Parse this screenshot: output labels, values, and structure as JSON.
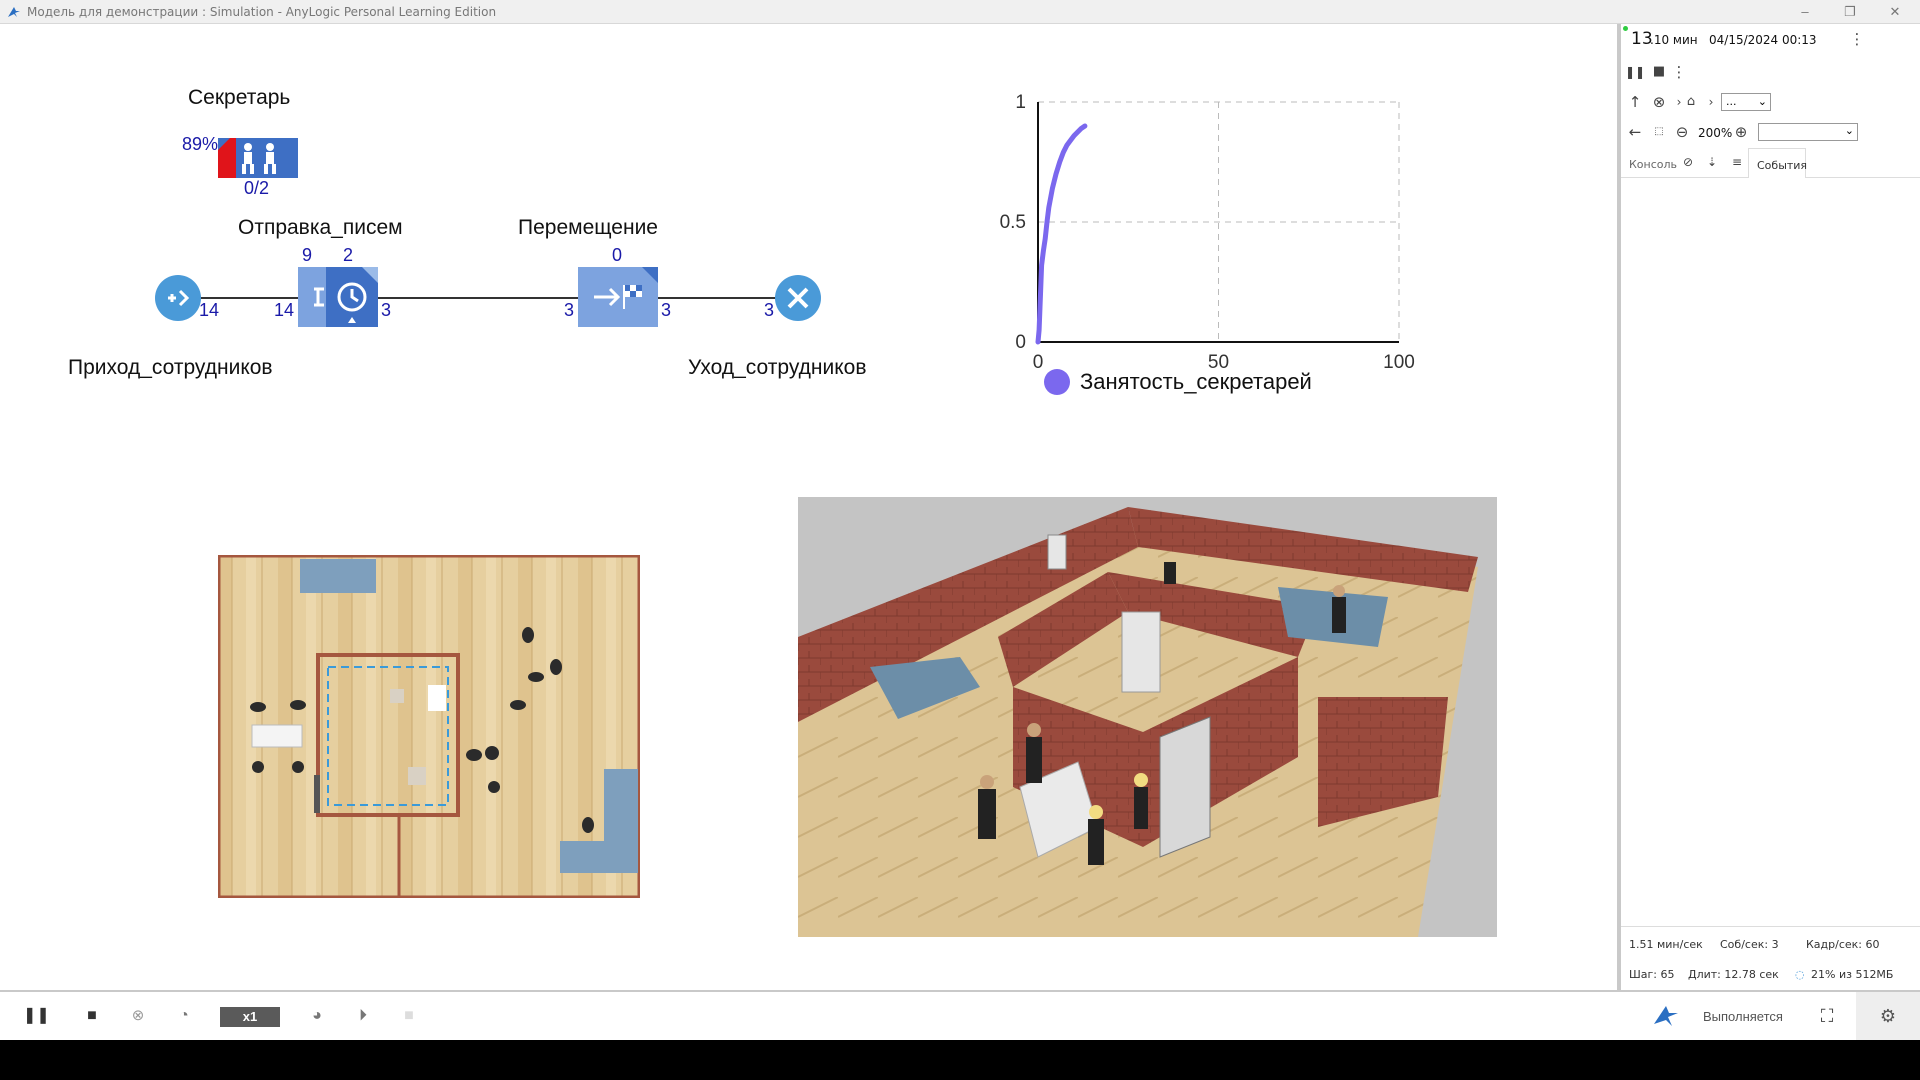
{
  "window": {
    "title": "Модель для демонстрации : Simulation - AnyLogic Personal Learning Edition",
    "minimize": "–",
    "restore": "❐",
    "close": "✕"
  },
  "process": {
    "secretary": {
      "label": "Секретарь",
      "utilization": "89%",
      "count": "0/2"
    },
    "delay": {
      "label": "Отправка_писем",
      "top_left": "9",
      "top_right": "2",
      "in": "14",
      "out": "3"
    },
    "move": {
      "label": "Перемещение",
      "top": "0",
      "in": "3",
      "out": "3"
    },
    "source": {
      "label": "Приход_сотрудников",
      "out": "14"
    },
    "sink": {
      "label": "Уход_сотрудников",
      "in": "3"
    }
  },
  "chart_data": {
    "type": "line",
    "title": "",
    "xlabel": "",
    "ylabel": "",
    "xlim": [
      0,
      100
    ],
    "ylim": [
      0,
      1
    ],
    "x_ticks": [
      "0",
      "50",
      "100"
    ],
    "y_ticks": [
      "0",
      "0.5",
      "1"
    ],
    "grid": true,
    "legend_position": "bottom",
    "series": [
      {
        "name": "Занятость_секретарей",
        "color": "#7b68ee",
        "x": [
          0,
          0.3,
          0.7,
          1,
          1.5,
          2,
          2.5,
          3,
          4,
          5,
          6,
          7,
          8,
          9,
          10,
          11,
          12,
          13
        ],
        "y": [
          0,
          0.05,
          0.2,
          0.32,
          0.38,
          0.43,
          0.5,
          0.56,
          0.64,
          0.7,
          0.75,
          0.79,
          0.82,
          0.84,
          0.86,
          0.875,
          0.89,
          0.9
        ]
      }
    ]
  },
  "panel": {
    "time_big": "13",
    "time_unit": ".10 мин",
    "date": "04/15/2024 00:13",
    "zoom": "200%",
    "nav_select": "...",
    "tab_console": "Консоль",
    "tab_events": "События",
    "stats": {
      "speed": "1.51 мин/сек",
      "events_per_sec": "Соб/сек: 3",
      "fps": "Кадр/сек: 60",
      "step": "Шаг: 65",
      "duration": "Длит: 12.78 сек",
      "memory": "21% из 512МБ"
    }
  },
  "bottom": {
    "speed_label": "x1",
    "status": "Выполняется"
  },
  "colors": {
    "accent": "#1a1aa8",
    "block_blue": "#3e6fc4",
    "source_blue": "#4a9ad8",
    "series": "#7b68ee"
  }
}
